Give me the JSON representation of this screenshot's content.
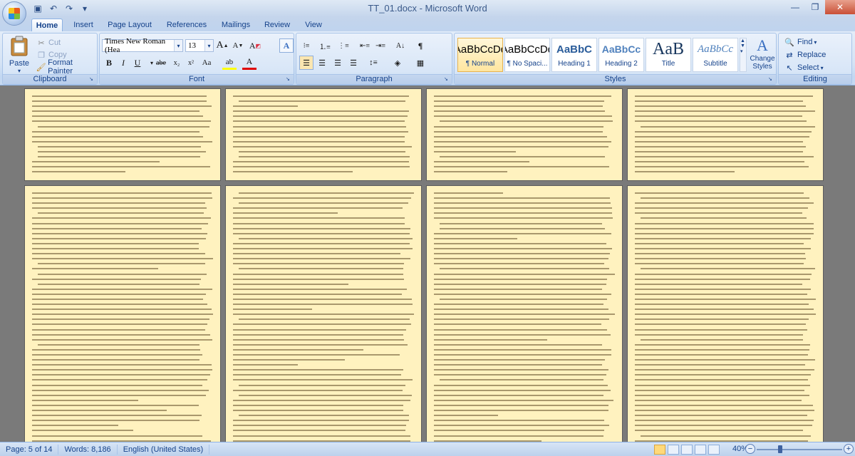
{
  "window": {
    "title": "TT_01.docx - Microsoft Word",
    "controls": {
      "minimize": "—",
      "maximize": "❐",
      "close": "✕"
    }
  },
  "quick_access": [
    {
      "name": "save-icon",
      "glyph": "💾"
    },
    {
      "name": "undo-icon",
      "glyph": "↶"
    },
    {
      "name": "redo-icon",
      "glyph": "↷"
    },
    {
      "name": "customize-qat-icon",
      "glyph": "▾"
    }
  ],
  "tabs": [
    "Home",
    "Insert",
    "Page Layout",
    "References",
    "Mailings",
    "Review",
    "View"
  ],
  "active_tab": "Home",
  "ribbon": {
    "clipboard": {
      "label": "Clipboard",
      "paste": "Paste",
      "cut": "Cut",
      "copy": "Copy",
      "format_painter": "Format Painter"
    },
    "font": {
      "label": "Font",
      "font_name": "Times New Roman (Hea",
      "font_size": "13",
      "grow": "A",
      "shrink": "A",
      "clear": "A",
      "bold": "B",
      "italic": "I",
      "underline": "U",
      "strike": "abe",
      "subscript": "x₂",
      "superscript": "x²",
      "change_case": "Aa",
      "highlight": "ab",
      "font_color": "A"
    },
    "paragraph": {
      "label": "Paragraph"
    },
    "styles": {
      "label": "Styles",
      "items": [
        {
          "preview": "AaBbCcDd",
          "name": "¶ Normal"
        },
        {
          "preview": "AaBbCcDd",
          "name": "¶ No Spaci..."
        },
        {
          "preview": "AaBbC",
          "name": "Heading 1"
        },
        {
          "preview": "AaBbCc",
          "name": "Heading 2"
        },
        {
          "preview": "AaB",
          "name": "Title"
        },
        {
          "preview": "AaBbCc",
          "name": "Subtitle"
        }
      ],
      "change_styles": "Change Styles"
    },
    "editing": {
      "label": "Editing",
      "find": "Find",
      "replace": "Replace",
      "select": "Select"
    }
  },
  "status": {
    "page": "Page: 5 of 14",
    "words": "Words: 8,186",
    "language": "English (United States)",
    "zoom": "40%"
  },
  "colors": {
    "page_background": "#fff2bf",
    "ribbon_text": "#15428b",
    "workspace": "#7a7a7a"
  }
}
